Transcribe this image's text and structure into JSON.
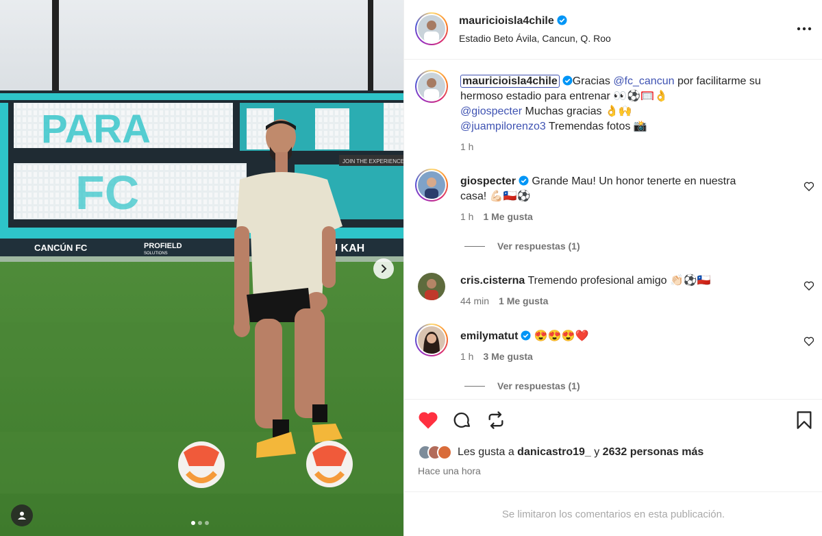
{
  "post": {
    "author": "mauricioisla4chile",
    "location": "Estadio Beto Ávila, Cancun, Q. Roo",
    "photo_signage": {
      "stadium_text": "CANCÚN FC",
      "ad_text": "PROFIELD",
      "ad_subtext": "SOLUTIONS",
      "ad_text_2": "NU KAH",
      "banner_text": "JOIN THE EXPERIENCE"
    },
    "photo_pages": 3,
    "photo_current_page": 1
  },
  "caption": {
    "author": "mauricioisla4chile",
    "text_1": "Gracias ",
    "mention_1": "@fc_cancun",
    "text_2": " por facilitarme su",
    "line_2": "hermoso estadio para entrenar 👀⚽🥅👌",
    "mention_2": "@giospecter",
    "line_3_text": " Muchas gracias 👌🙌",
    "mention_3": "@juampilorenzo3",
    "line_4_text": " Tremendas fotos 📸",
    "time": "1 h"
  },
  "comments": [
    {
      "user": "giospecter",
      "text_line1": "Grande Mau! Un honor tenerte en nuestra",
      "text_line2": "casa! 💪🏻🇨🇱⚽",
      "time": "1 h",
      "likes": "1 Me gusta",
      "replies": "Ver respuestas (1)"
    },
    {
      "user": "cris.cisterna",
      "text_line1": "Tremendo profesional amigo 👏🏻⚽🇨🇱",
      "time": "44 min",
      "likes": "1 Me gusta"
    },
    {
      "user": "emilymatut",
      "text_line1": "😍😍😍❤️",
      "time": "1 h",
      "likes": "3 Me gusta",
      "replies": "Ver respuestas (1)"
    }
  ],
  "likes": {
    "prefix": "Les gusta a ",
    "user": "danicastro19_",
    "middle": " y ",
    "count": "2632 personas más"
  },
  "time_ago": "Hace una hora",
  "comments_limited": "Se limitaron los comentarios en esta publicación.",
  "colors": {
    "like_red": "#ff3040",
    "link_blue": "#3e52b2",
    "verified_blue": "#0095f6",
    "muted": "#737373"
  },
  "icons": [
    "verified-badge-icon",
    "more-options-icon",
    "heart-icon",
    "comment-icon",
    "repost-icon",
    "save-icon",
    "chevron-right-icon",
    "user-tag-icon"
  ]
}
